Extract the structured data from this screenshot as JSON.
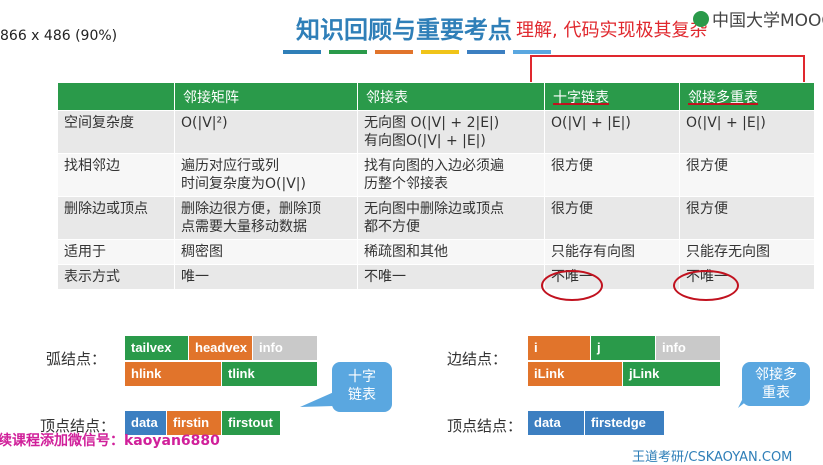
{
  "header": {
    "size_label": "866 x 486 (90%)",
    "title": "知识回顾与重要考点",
    "annotation": "理解, 代码实现极其复杂",
    "logo": "中国大学MOOC"
  },
  "colors": {
    "accent_green": "#2a9a4a",
    "title_blue": "#2f7fb8",
    "annotation_red": "#e0282e",
    "bar": [
      "#2f7fb8",
      "#2a9a4a",
      "#e1742b",
      "#f0c419",
      "#3c7fc1",
      "#5aa7e0"
    ]
  },
  "table": {
    "headers": [
      "",
      "邻接矩阵",
      "邻接表",
      "十字链表",
      "邻接多重表"
    ],
    "rows": [
      [
        "空间复杂度",
        "O(|V|²)",
        "无向图 O(|V| + 2|E|)\n有向图O(|V| + |E|)",
        "O(|V| + |E|)",
        "O(|V| + |E|)"
      ],
      [
        "找相邻边",
        "遍历对应行或列\n时间复杂度为O(|V|)",
        "找有向图的入边必须遍\n历整个邻接表",
        "很方便",
        "很方便"
      ],
      [
        "删除边或顶点",
        "删除边很方便，删除顶\n点需要大量移动数据",
        "无向图中删除边或顶点\n都不方便",
        "很方便",
        "很方便"
      ],
      [
        "适用于",
        "稠密图",
        "稀疏图和其他",
        "只能存有向图",
        "只能存无向图"
      ],
      [
        "表示方式",
        "唯一",
        "不唯一",
        "不唯一",
        "不唯一"
      ]
    ]
  },
  "nodes": {
    "arc_label": "弧结点：",
    "arc_row1": [
      "tailvex",
      "headvex",
      "info"
    ],
    "arc_row2": [
      "hlink",
      "tlink"
    ],
    "vertex_label_left": "顶点结点：",
    "vertex_left": [
      "data",
      "firstin",
      "firstout"
    ],
    "callout_left": "十字\n链表",
    "edge_label": "边结点：",
    "edge_row1": [
      "i",
      "j",
      "info"
    ],
    "edge_row2": [
      "iLink",
      "jLink"
    ],
    "vertex_label_right": "顶点结点：",
    "vertex_right": [
      "data",
      "firstedge"
    ],
    "callout_right": "邻接多\n重表"
  },
  "watermark": "续课程添加微信号：kaoyan6880",
  "footer": "王道考研/CSKAOYAN.COM"
}
